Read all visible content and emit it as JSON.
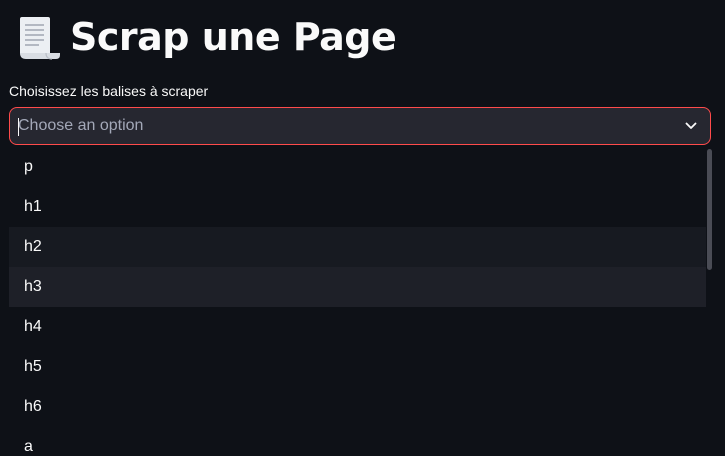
{
  "header": {
    "icon": "scroll-icon",
    "title": "Scrap une Page"
  },
  "multiselect": {
    "label": "Choisissez les balises à scraper",
    "placeholder": "Choose an option",
    "chevron_icon": "chevron-down-icon",
    "accent_color": "#ff4b4b"
  },
  "dropdown": {
    "options": [
      {
        "label": "p"
      },
      {
        "label": "h1"
      },
      {
        "label": "h2"
      },
      {
        "label": "h3"
      },
      {
        "label": "h4"
      },
      {
        "label": "h5"
      },
      {
        "label": "h6"
      },
      {
        "label": "a"
      }
    ]
  },
  "colors": {
    "background": "#0e1117",
    "input_background": "#262730",
    "text": "#fafafa"
  }
}
